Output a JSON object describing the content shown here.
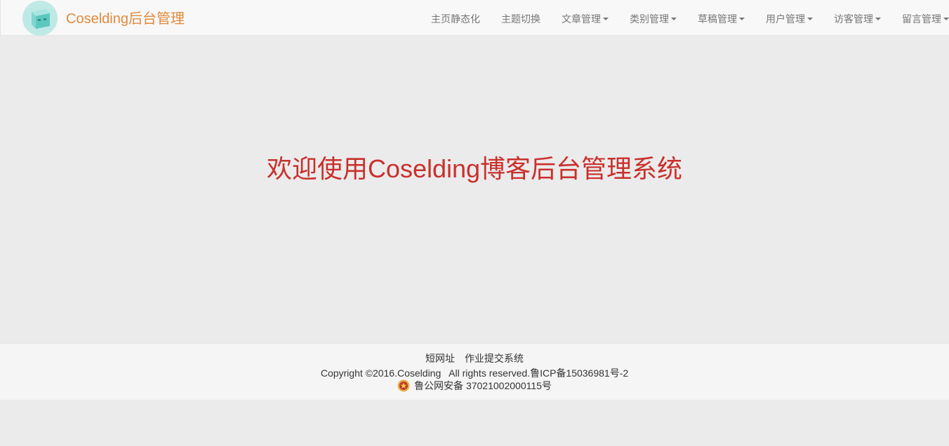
{
  "brand": {
    "name": "Coselding后台管理",
    "logo_icon": "cube-avatar-icon"
  },
  "nav": {
    "items": [
      {
        "label": "主页静态化",
        "dropdown": false
      },
      {
        "label": "主题切换",
        "dropdown": false
      },
      {
        "label": "文章管理",
        "dropdown": true
      },
      {
        "label": "类别管理",
        "dropdown": true
      },
      {
        "label": "草稿管理",
        "dropdown": true
      },
      {
        "label": "用户管理",
        "dropdown": true
      },
      {
        "label": "访客管理",
        "dropdown": true
      },
      {
        "label": "留言管理",
        "dropdown": true
      }
    ]
  },
  "main": {
    "welcome": "欢迎使用Coselding博客后台管理系统"
  },
  "footer": {
    "links": [
      "短网址",
      "作业提交系统"
    ],
    "copyright": "Copyright ©2016.Coselding   All rights reserved.鲁ICP备15036981号-2",
    "beian": "鲁公网安备 37021002000115号",
    "beian_icon": "police-badge-icon"
  },
  "colors": {
    "brand": "#e08a3c",
    "welcome": "#c9302c",
    "background": "#ebebeb",
    "navbar": "#f8f8f8"
  }
}
